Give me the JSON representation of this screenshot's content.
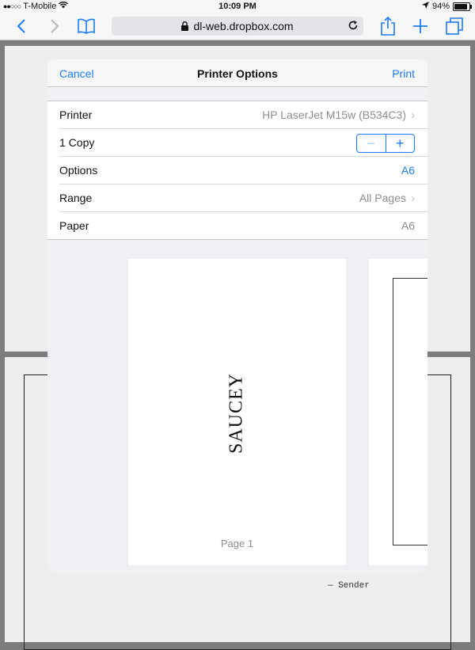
{
  "status_bar": {
    "carrier": "T-Mobile",
    "time": "10:09 PM",
    "battery": "94%"
  },
  "browser": {
    "url": "dl-web.dropbox.com"
  },
  "background_doc": {
    "sender_text": "— Sender"
  },
  "dialog": {
    "cancel_label": "Cancel",
    "title": "Printer Options",
    "print_label": "Print",
    "rows": [
      {
        "label": "Printer",
        "value": "HP LaserJet M15w (B534C3)"
      },
      {
        "label": "1 Copy"
      },
      {
        "label": "Options",
        "value": "A6"
      },
      {
        "label": "Range",
        "value": "All Pages"
      },
      {
        "label": "Paper",
        "value": "A6"
      }
    ],
    "stepper": {
      "minus": "−",
      "plus": "+"
    }
  },
  "preview": {
    "page_text": "SAUCEY",
    "page_label": "Page 1"
  },
  "colors": {
    "accent": "#1b7cf6",
    "secondary_text": "#8e8e93"
  }
}
